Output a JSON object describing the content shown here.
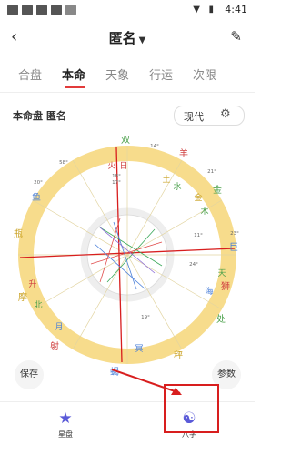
{
  "status_bar": {
    "time": "4:41",
    "icons": [
      "a-icon",
      "wifi-icon",
      "battery-icon"
    ]
  },
  "header": {
    "title": "匿名",
    "back_icon": "chevron-left-icon",
    "edit_icon": "edit-icon"
  },
  "tabs": [
    {
      "label": "合盘",
      "active": false
    },
    {
      "label": "本命",
      "active": true
    },
    {
      "label": "天象",
      "active": false
    },
    {
      "label": "行运",
      "active": false
    },
    {
      "label": "次限",
      "active": false
    }
  ],
  "chart_header": {
    "label": "本命盘",
    "name": "匿名",
    "mode": "现代"
  },
  "wheel": {
    "signs": [
      "双",
      "羊",
      "金",
      "巨",
      "狮",
      "处",
      "秤",
      "蝎",
      "射",
      "摩",
      "瓶",
      "鱼"
    ],
    "planets_labels": [
      "火",
      "日",
      "土",
      "木",
      "金",
      "冥",
      "海",
      "天",
      "水",
      "月",
      "升",
      "北"
    ],
    "numbers": [
      "14°",
      "21°",
      "23°",
      "20°",
      "18°",
      "17°",
      "11°",
      "24°",
      "19°",
      "58°"
    ]
  },
  "buttons": {
    "save": "保存",
    "params": "参数"
  },
  "bottom_nav": {
    "left_label": "星盘",
    "right_label": "八字"
  },
  "colors": {
    "accent": "#e23b3b",
    "ring": "#f7dc8c"
  }
}
